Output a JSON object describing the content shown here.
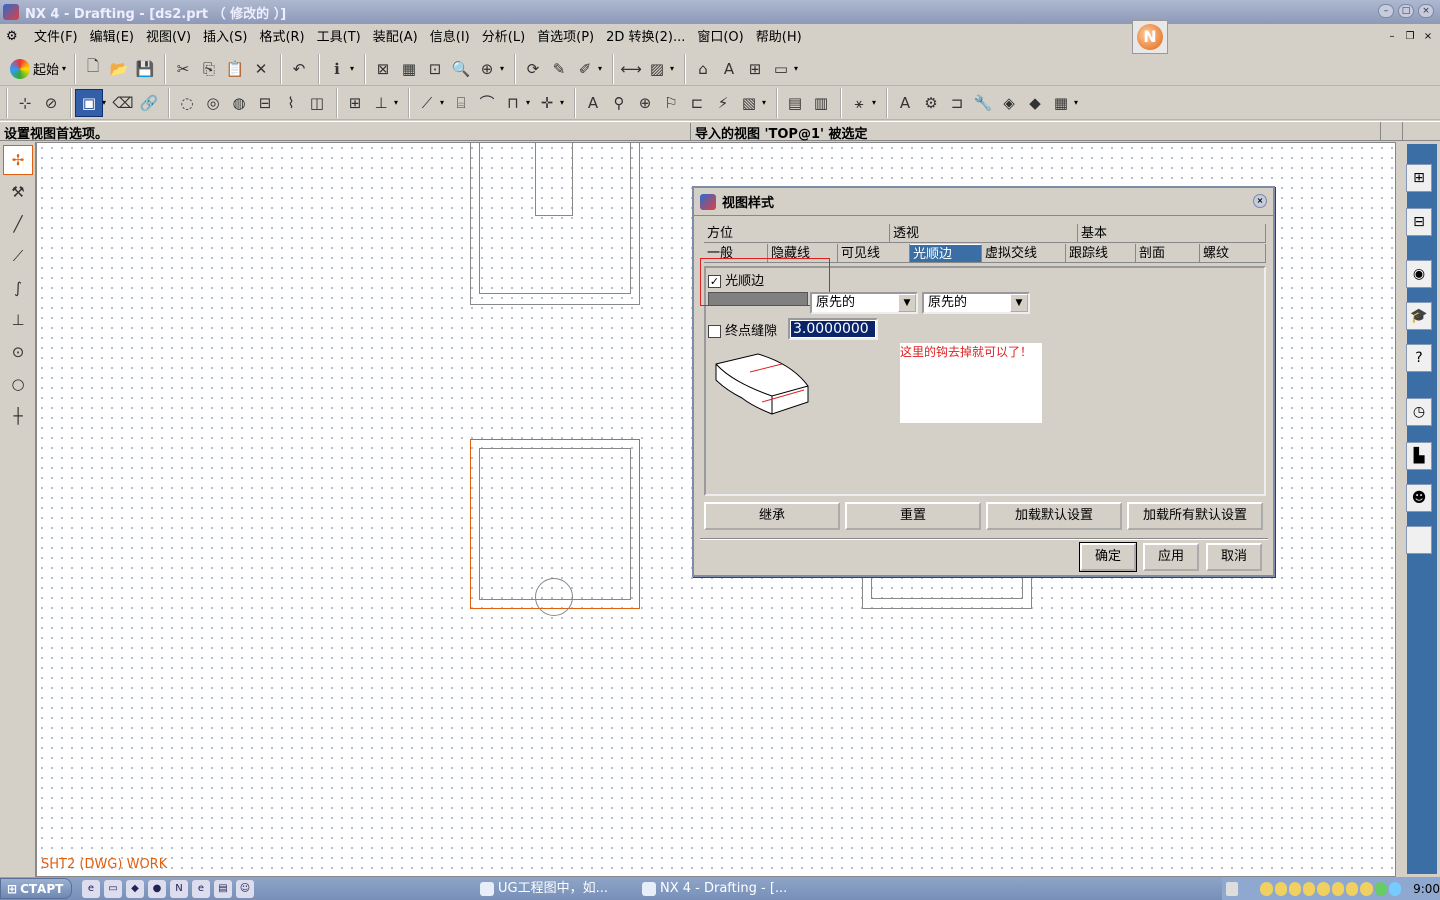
{
  "window": {
    "title": "NX 4 - Drafting - [ds2.prt （ 修改的 ）]"
  },
  "menubar": {
    "items": [
      "文件(F)",
      "编辑(E)",
      "视图(V)",
      "插入(S)",
      "格式(R)",
      "工具(T)",
      "装配(A)",
      "信息(I)",
      "分析(L)",
      "首选项(P)",
      "2D 转换(2)...",
      "窗口(O)",
      "帮助(H)"
    ]
  },
  "toolbar": {
    "start_label": "起始"
  },
  "statusbar": {
    "prompt": "设置视图首选项。",
    "message": "导入的视图 'TOP@1' 被选定"
  },
  "canvas": {
    "work_label": "SHT2 (DWG) WORK"
  },
  "dialog": {
    "title": "视图样式",
    "tabs_row1": [
      "方位",
      "透视",
      "基本"
    ],
    "tabs_row2": [
      "一般",
      "隐藏线",
      "可见线",
      "光顺边",
      "虚拟交线",
      "跟踪线",
      "剖面",
      "螺纹"
    ],
    "active_tab": "光顺边",
    "smooth_edge_label": "光顺边",
    "smooth_edge_checked": "✓",
    "font_value": "原先的",
    "width_value": "原先的",
    "endpoint_gap_label": "终点缝隙",
    "endpoint_gap_value": "3.0000000",
    "annotation": "这里的钩去掉就可以了！",
    "buttons": {
      "inherit": "继承",
      "reset": "重置",
      "load_default": "加载默认设置",
      "load_all_default": "加载所有默认设置",
      "ok": "确定",
      "apply": "应用",
      "cancel": "取消"
    }
  },
  "taskbar": {
    "start": "СТАРТ",
    "tasks": [
      "UG工程图中，如...",
      "NX 4 - Drafting - [..."
    ],
    "clock": "9:00"
  }
}
